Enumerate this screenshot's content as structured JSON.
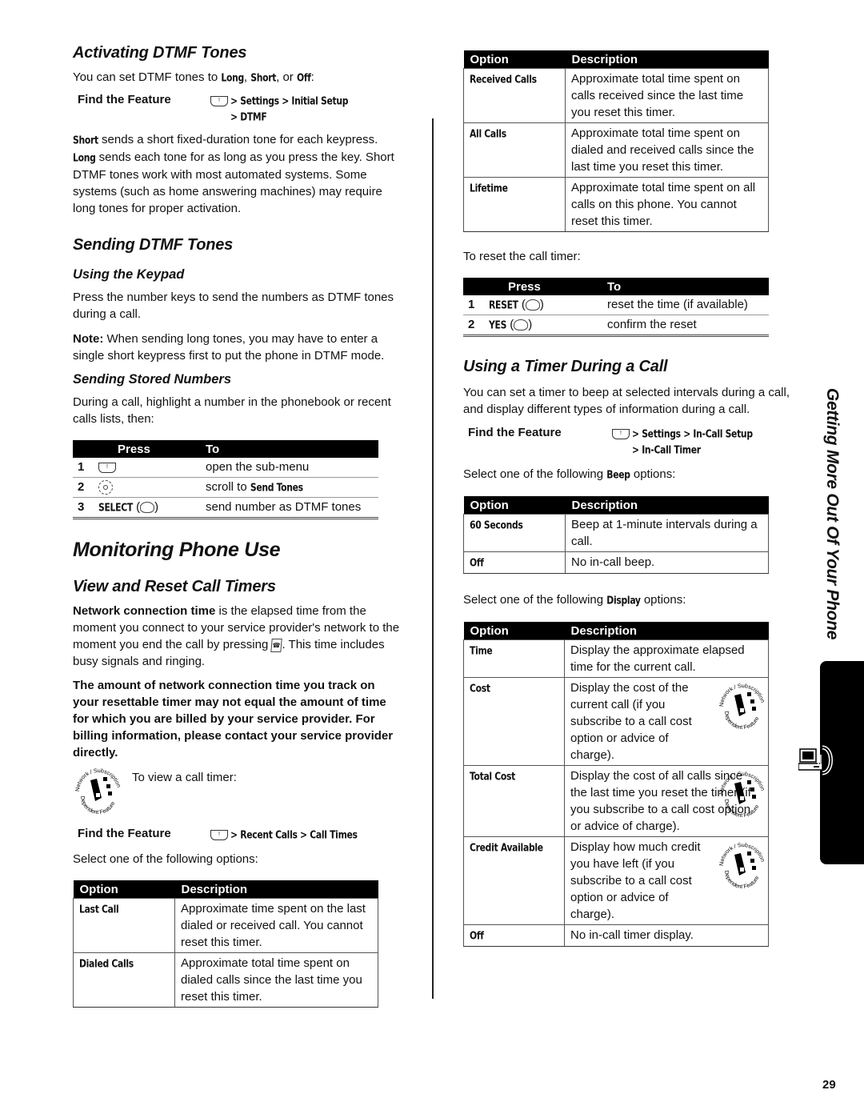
{
  "left": {
    "activating": {
      "title": "Activating DTMF Tones",
      "intro_pre": "You can set DTMF tones to ",
      "intro_long": "Long",
      "intro_sep1": ", ",
      "intro_short": "Short",
      "intro_sep2": ", or ",
      "intro_off": "Off",
      "intro_end": ":",
      "find_label": "Find the Feature",
      "path_line1": "> Settings > Initial Setup",
      "path_line2": "> DTMF",
      "short_kw": "Short",
      "short_text": " sends a short fixed-duration tone for each keypress.",
      "long_kw": "Long",
      "long_text": " sends each tone for as long as you press the key. Short DTMF tones work with most automated systems. Some systems (such as home answering machines) may require long tones for proper activation."
    },
    "sending": {
      "title": "Sending DTMF Tones",
      "keypad_title": "Using the Keypad",
      "keypad_text": "Press the number keys to send the numbers as DTMF tones during a call.",
      "note_label": "Note:",
      "note_text": " When sending long tones, you may have to enter a single short keypress first to put the phone in DTMF mode.",
      "stored_title": "Sending Stored Numbers",
      "stored_text": "During a call, highlight a number in the phonebook or recent calls lists, then:",
      "table": {
        "headers": [
          "Press",
          "To"
        ],
        "rows": [
          {
            "n": "1",
            "key": "menu-key",
            "key_label": "",
            "to_pre": "open the sub-menu",
            "to_kw": ""
          },
          {
            "n": "2",
            "key": "nav-key",
            "key_label": "",
            "to_pre": "scroll to ",
            "to_kw": "Send Tones"
          },
          {
            "n": "3",
            "key": "softkey-right",
            "key_label": "SELECT",
            "to_pre": "send number as DTMF tones",
            "to_kw": ""
          }
        ]
      }
    },
    "monitoring": {
      "title": "Monitoring Phone Use",
      "view_title": "View and Reset Call Timers",
      "ncd_bold": "Network connection time",
      "ncd_text1": " is the elapsed time from the moment you connect to your service provider's network to the moment you end the call by pressing ",
      "ncd_text2": ". This time includes busy signals and ringing.",
      "warning": "The amount of network connection time you track on your resettable timer may not equal the amount of time for which you are billed by your service provider. For billing information, please contact your service provider directly.",
      "view_timer": "To view a call timer:",
      "find_label": "Find the Feature",
      "path": "> Recent Calls > Call Times",
      "select_text": "Select one of the following options:",
      "table": {
        "headers": [
          "Option",
          "Description"
        ],
        "rows": [
          {
            "option": "Last Call",
            "desc": "Approximate time spent on the last dialed or received call. You cannot reset this timer."
          },
          {
            "option": "Dialed Calls",
            "desc": "Approximate total time spent on dialed calls since the last time you reset this timer."
          }
        ]
      }
    }
  },
  "right": {
    "timers_table": {
      "headers": [
        "Option",
        "Description"
      ],
      "rows": [
        {
          "option": "Received Calls",
          "desc": "Approximate total time spent on calls received since the last time you reset this timer."
        },
        {
          "option": "All Calls",
          "desc": "Approximate total time spent on dialed and received calls since the last time you reset this timer."
        },
        {
          "option": "Lifetime",
          "desc": "Approximate total time spent on all calls on this phone. You cannot reset this timer."
        }
      ]
    },
    "reset_text": "To reset the call timer:",
    "reset_table": {
      "headers": [
        "Press",
        "To"
      ],
      "rows": [
        {
          "n": "1",
          "key_label": "RESET",
          "to": "reset the time (if available)"
        },
        {
          "n": "2",
          "key_label": "YES",
          "to": "confirm the reset"
        }
      ]
    },
    "during_call": {
      "title": "Using a Timer During a Call",
      "intro": "You can set a timer to beep at selected intervals during a call, and display different types of information during a call.",
      "find_label": "Find the Feature",
      "path_line1": "> Settings > In-Call Setup",
      "path_line2": "> In-Call Timer",
      "beep_pre": "Select one of the following ",
      "beep_kw": "Beep",
      "beep_post": " options:",
      "beep_table": {
        "headers": [
          "Option",
          "Description"
        ],
        "rows": [
          {
            "option": "60 Seconds",
            "desc": "Beep at 1-minute intervals during a call."
          },
          {
            "option": "Off",
            "desc": "No in-call beep."
          }
        ]
      },
      "display_pre": "Select one of the following ",
      "display_kw": "Display",
      "display_post": " options:",
      "display_table": {
        "headers": [
          "Option",
          "Description"
        ],
        "rows": [
          {
            "option": "Time",
            "desc": "Display the approximate elapsed time for the current call.",
            "network_icon": false
          },
          {
            "option": "Cost",
            "desc": "Display the cost of the current call (if you subscribe to a call cost option or advice of charge).",
            "network_icon": true
          },
          {
            "option": "Total Cost",
            "desc": "Display the cost of all calls since the last time you reset the timer (if you subscribe to a call cost option or advice of charge).",
            "network_icon": true
          },
          {
            "option": "Credit Available",
            "desc": "Display how much credit you have left (if you subscribe to a call cost option or advice of charge).",
            "network_icon": true
          },
          {
            "option": "Off",
            "desc": "No in-call timer display.",
            "network_icon": false
          }
        ]
      }
    }
  },
  "side_tab": {
    "label": "Getting More Out Of Your Phone",
    "icon": "computer-phone-icon"
  },
  "network_badge": {
    "top_text": "Network / Subscription",
    "bottom_text": "Dependent Feature"
  },
  "page_number": "29"
}
